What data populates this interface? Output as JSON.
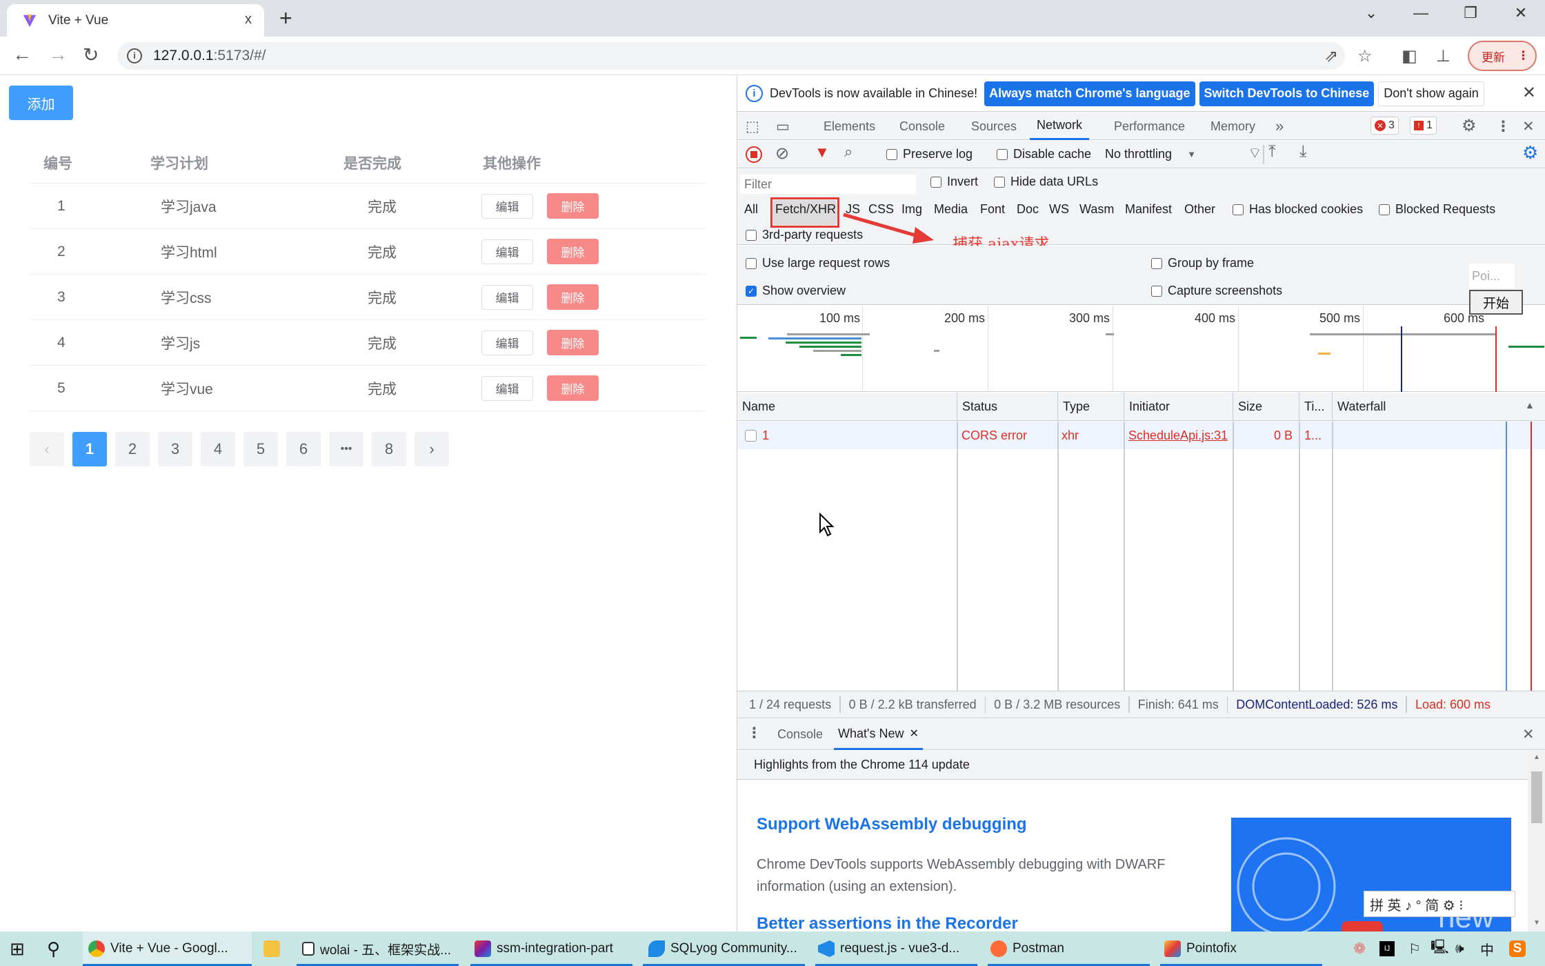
{
  "browser": {
    "tab_title": "Vite + Vue",
    "tab_close": "x",
    "new_tab": "+",
    "url_host": "127.0.0.1",
    "url_path": ":5173/#/",
    "update_label": "更新",
    "window_controls": {
      "tab_search": "⌄",
      "minimize": "—",
      "restore": "❐",
      "close": "✕"
    }
  },
  "app": {
    "add_button": "添加",
    "table": {
      "headers": [
        "编号",
        "学习计划",
        "是否完成",
        "其他操作"
      ],
      "rows": [
        {
          "id": "1",
          "plan": "学习java",
          "done": "完成"
        },
        {
          "id": "2",
          "plan": "学习html",
          "done": "完成"
        },
        {
          "id": "3",
          "plan": "学习css",
          "done": "完成"
        },
        {
          "id": "4",
          "plan": "学习js",
          "done": "完成"
        },
        {
          "id": "5",
          "plan": "学习vue",
          "done": "完成"
        }
      ],
      "edit_label": "编辑",
      "delete_label": "删除"
    },
    "pagination": {
      "prev": "‹",
      "pages": [
        "1",
        "2",
        "3",
        "4",
        "5",
        "6",
        "•••",
        "8"
      ],
      "current": "1",
      "next": "›"
    }
  },
  "devtools": {
    "infobar": {
      "message": "DevTools is now available in Chinese!",
      "btn_match": "Always match Chrome's language",
      "btn_switch": "Switch DevTools to Chinese",
      "btn_dont_show": "Don't show again"
    },
    "tabs": [
      "Elements",
      "Console",
      "Sources",
      "Network",
      "Performance",
      "Memory"
    ],
    "active_tab": "Network",
    "more_tabs": "»",
    "error_count": "3",
    "issue_count": "1",
    "network_toolbar": {
      "preserve_log": "Preserve log",
      "disable_cache": "Disable cache",
      "throttling": "No throttling"
    },
    "filter": {
      "placeholder": "Filter",
      "invert": "Invert",
      "hide_data_urls": "Hide data URLs",
      "types": [
        "All",
        "Fetch/XHR",
        "JS",
        "CSS",
        "Img",
        "Media",
        "Font",
        "Doc",
        "WS",
        "Wasm",
        "Manifest",
        "Other"
      ],
      "active_type": "Fetch/XHR",
      "has_blocked_cookies": "Has blocked cookies",
      "blocked_requests": "Blocked Requests",
      "third_party": "3rd-party requests"
    },
    "annotation": "捕获 ajax请求",
    "settings": {
      "large_rows": "Use large request rows",
      "group_by_frame": "Group by frame",
      "show_overview": "Show overview",
      "show_overview_checked": true,
      "capture_screenshots": "Capture screenshots"
    },
    "overview_ticks": [
      "100 ms",
      "200 ms",
      "300 ms",
      "400 ms",
      "500 ms",
      "600 ms"
    ],
    "columns": [
      "Name",
      "Status",
      "Type",
      "Initiator",
      "Size",
      "Ti...",
      "Waterfall"
    ],
    "requests": [
      {
        "name": "1",
        "status": "CORS error",
        "type": "xhr",
        "initiator": "ScheduleApi.js:31",
        "size": "0 B",
        "time": "1..."
      }
    ],
    "summary": {
      "requests": "1 / 24 requests",
      "transferred": "0 B / 2.2 kB transferred",
      "resources": "0 B / 3.2 MB resources",
      "finish": "Finish: 641 ms",
      "dom_content_loaded": "DOMContentLoaded: 526 ms",
      "load": "Load: 600 ms"
    },
    "drawer": {
      "tabs": [
        "Console",
        "What's New"
      ],
      "active": "What's New",
      "highlights": "Highlights from the Chrome 114 update",
      "section1_title": "Support WebAssembly debugging",
      "section1_body": "Chrome DevTools supports WebAssembly debugging with DWARF information (using an extension).",
      "section2_title": "Better assertions in the Recorder",
      "image_text": "new"
    }
  },
  "pointofix": {
    "title": "Poi...",
    "start": "开始"
  },
  "ime_bar": "拼 英 ♪ ° 简 ⚙ ⁝",
  "taskbar": {
    "items": [
      {
        "label": "Vite + Vue - Googl...",
        "icon": "chrome-icon"
      },
      {
        "label": "",
        "icon": "folder-icon"
      },
      {
        "label": "wolai - 五、框架实战...",
        "icon": "wolai-icon"
      },
      {
        "label": "ssm-integration-part",
        "icon": "intellij-icon"
      },
      {
        "label": "SQLyog Community...",
        "icon": "sqlyog-icon"
      },
      {
        "label": "request.js - vue3-d...",
        "icon": "vscode-icon"
      },
      {
        "label": "Postman",
        "icon": "postman-icon"
      },
      {
        "label": "Pointofix",
        "icon": "pointofix-icon"
      }
    ],
    "tray_lang": "中"
  },
  "colors": {
    "primary": "#409eff",
    "danger": "#f78989",
    "devtools_blue": "#1a73e8",
    "error_red": "#d93025"
  }
}
